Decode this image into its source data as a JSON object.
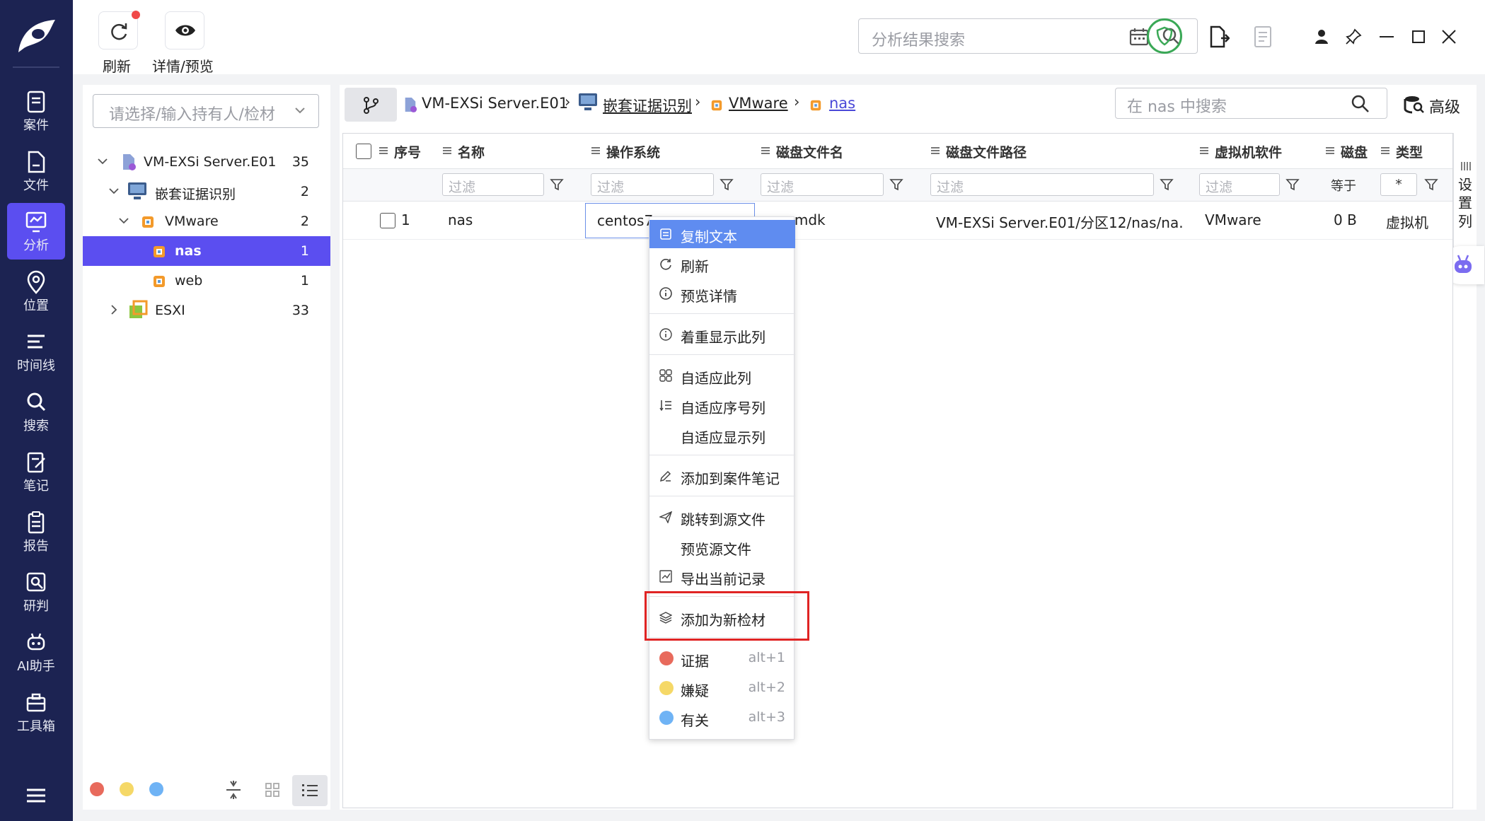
{
  "sidebar": {
    "items": [
      {
        "label": "案件",
        "icon": "briefcase-doc-icon"
      },
      {
        "label": "文件",
        "icon": "file-icon"
      },
      {
        "label": "分析",
        "icon": "analysis-monitor-icon"
      },
      {
        "label": "位置",
        "icon": "location-pin-icon"
      },
      {
        "label": "时间线",
        "icon": "timeline-icon"
      },
      {
        "label": "搜索",
        "icon": "search-icon"
      },
      {
        "label": "笔记",
        "icon": "note-icon"
      },
      {
        "label": "报告",
        "icon": "report-icon"
      },
      {
        "label": "研判",
        "icon": "judge-icon"
      },
      {
        "label": "AI助手",
        "icon": "robot-icon"
      },
      {
        "label": "工具箱",
        "icon": "toolbox-icon"
      }
    ],
    "active": "分析"
  },
  "toolbar": {
    "refresh_label": "刷新",
    "preview_label": "详情/预览"
  },
  "global_search": {
    "placeholder": "分析结果搜索"
  },
  "tree": {
    "holder_placeholder": "请选择/输入持有人/检材",
    "nodes": [
      {
        "label": "VM-EXSi Server.E01",
        "count": "35"
      },
      {
        "label": "嵌套证据识别",
        "count": "2"
      },
      {
        "label": "VMware",
        "count": "2"
      },
      {
        "label": "nas",
        "count": "1"
      },
      {
        "label": "web",
        "count": "1"
      },
      {
        "label": "ESXI",
        "count": "33"
      }
    ]
  },
  "breadcrumb": {
    "items": [
      "VM-EXSi Server.E01",
      "嵌套证据识别",
      "VMware",
      "nas"
    ]
  },
  "local_search": {
    "placeholder": "在 nas 中搜索"
  },
  "advanced_label": "高级",
  "settings_col_label": "设置列",
  "table": {
    "columns": [
      "序号",
      "名称",
      "操作系统",
      "磁盘文件名",
      "磁盘文件路径",
      "虚拟机软件",
      "磁盘",
      "类型"
    ],
    "filter_placeholder": "过滤",
    "filter_equal": "等于",
    "filter_star": "*",
    "rows": [
      {
        "index": "1",
        "name": "nas",
        "os": "centos7",
        "disk_file": "vmdk",
        "disk_path": "VM-EXSi Server.E01/分区12/nas/na...",
        "vm_software": "VMware",
        "disk_size": "0 B",
        "type": "虚拟机"
      }
    ]
  },
  "context_menu": {
    "items": [
      {
        "label": "复制文本"
      },
      {
        "label": "刷新"
      },
      {
        "label": "预览详情"
      },
      {
        "label": "着重显示此列"
      },
      {
        "label": "自适应此列"
      },
      {
        "label": "自适应序号列"
      },
      {
        "label": "自适应显示列"
      },
      {
        "label": "添加到案件笔记"
      },
      {
        "label": "跳转到源文件"
      },
      {
        "label": "预览源文件"
      },
      {
        "label": "导出当前记录"
      },
      {
        "label": "添加为新检材"
      },
      {
        "label": "证据",
        "shortcut": "alt+1"
      },
      {
        "label": "嫌疑",
        "shortcut": "alt+2"
      },
      {
        "label": "有关",
        "shortcut": "alt+3"
      }
    ]
  },
  "colors": {
    "sidebar": "#1c2352",
    "accent": "#5b4ef0",
    "menu_highlight": "#5f8cf0",
    "evidence": "#e86a5c",
    "suspect": "#f5d867",
    "related": "#6fb3f5",
    "alert_box": "#e02424"
  }
}
